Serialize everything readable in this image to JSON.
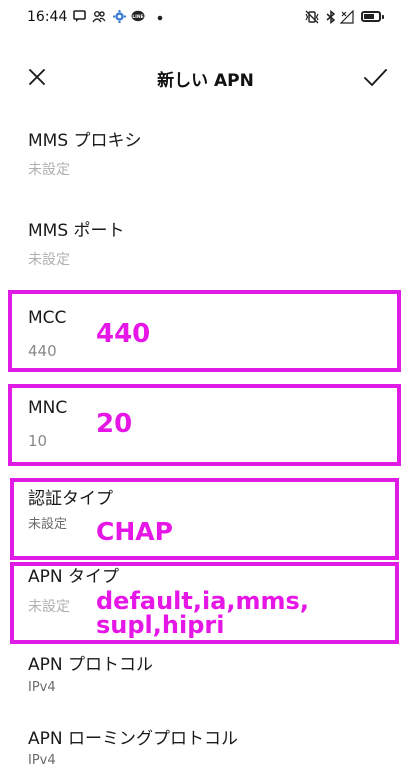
{
  "status_bar": {
    "time": "16:44",
    "left_icons": [
      "chat-icon",
      "people-icon",
      "gear-icon",
      "line-icon",
      "dot-icon"
    ],
    "right_icons": [
      "vibrate-icon",
      "bluetooth-icon",
      "no-signal-icon",
      "battery-icon"
    ],
    "battery_level": 0.7
  },
  "header": {
    "title": "新しい APN",
    "close_icon": "close-icon",
    "confirm_icon": "check-icon"
  },
  "fields": [
    {
      "label": "MMS プロキシ",
      "value": "未設定"
    },
    {
      "label": "MMS ポート",
      "value": "未設定"
    },
    {
      "label": "MCC",
      "value": "440"
    },
    {
      "label": "MNC",
      "value": "10"
    },
    {
      "label": "認証タイプ",
      "value": "未設定"
    },
    {
      "label": "APN タイプ",
      "value": "未設定"
    },
    {
      "label": "APN プロトコル",
      "value": "IPv4"
    },
    {
      "label": "APN ローミングプロトコル",
      "value": "IPv4"
    }
  ],
  "annotations": {
    "mcc": "440",
    "mnc": "20",
    "auth": "CHAP",
    "apn_type_line1": "default,ia,mms,",
    "apn_type_line2": "supl,hipri"
  },
  "colors": {
    "annotation": "#e11be6",
    "placeholder": "#b0b0b0"
  }
}
